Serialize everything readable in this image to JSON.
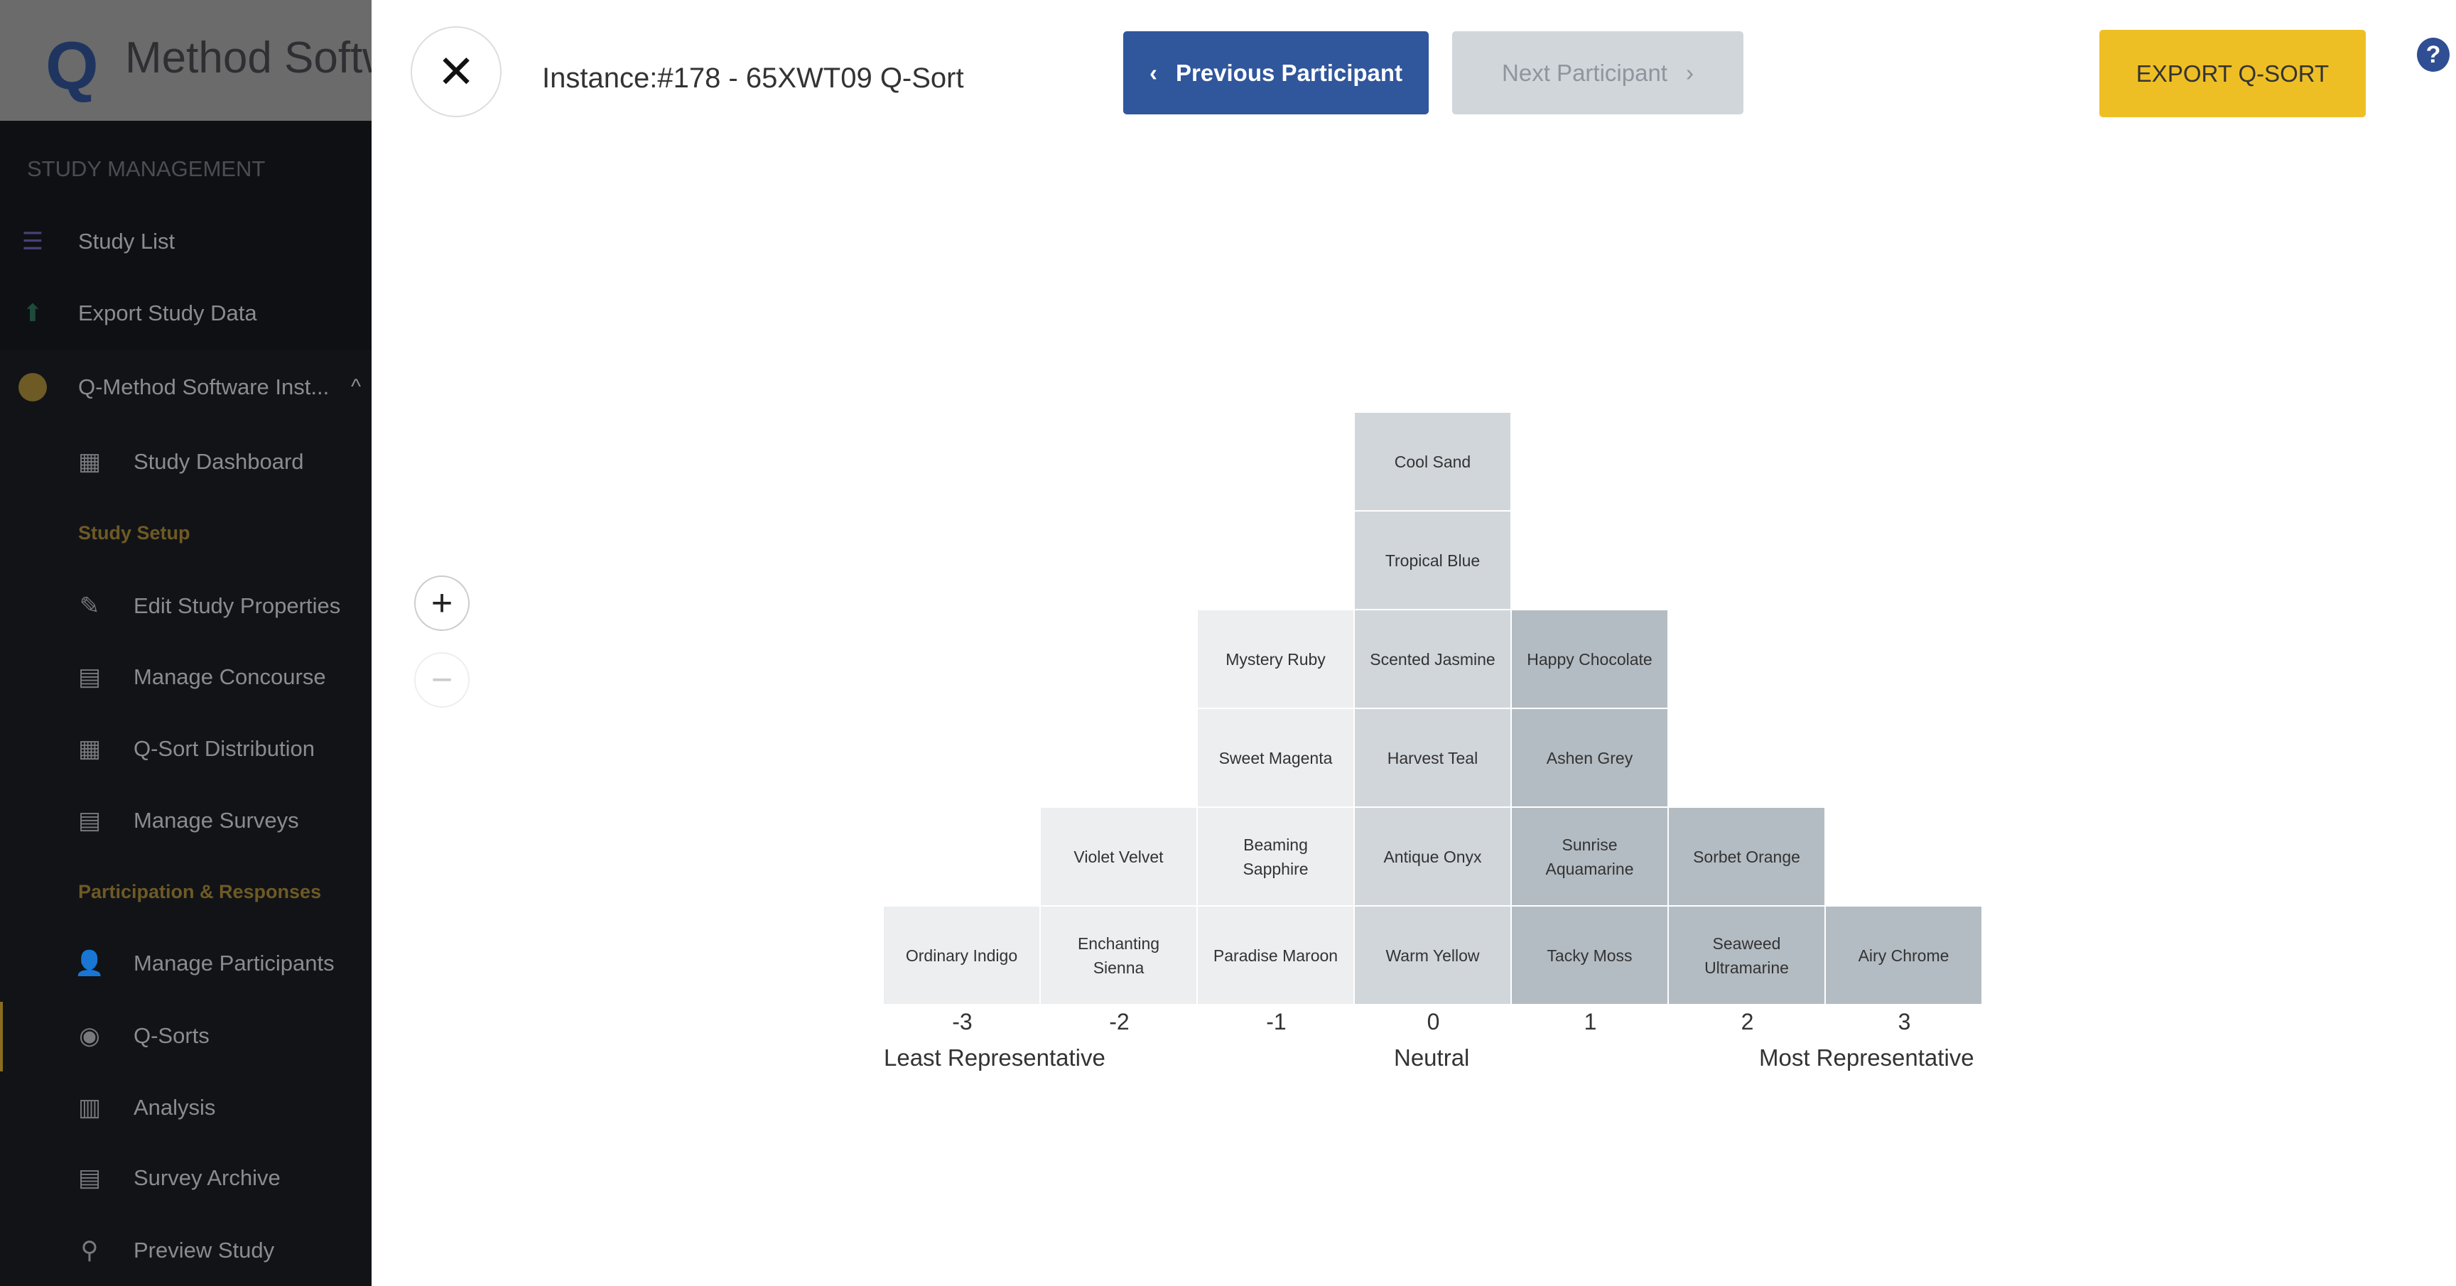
{
  "sidebar": {
    "logo_text": "Method Software",
    "logo_letter": "Q",
    "section_title": "STUDY MANAGEMENT",
    "top_items": [
      {
        "label": "Study List",
        "icon": "list-icon"
      },
      {
        "label": "Export Study Data",
        "icon": "upload-icon"
      },
      {
        "label": "Q-Method Software Inst...",
        "icon": "compass-icon"
      }
    ],
    "sub_items": [
      {
        "label": "Study Dashboard",
        "icon": "dashboard-icon"
      }
    ],
    "group_setup": "Study Setup",
    "setup_items": [
      {
        "label": "Edit Study Properties"
      },
      {
        "label": "Manage Concourse"
      },
      {
        "label": "Q-Sort Distribution"
      },
      {
        "label": "Manage Surveys"
      }
    ],
    "group_participation": "Participation & Responses",
    "participation_items": [
      {
        "label": "Manage Participants"
      },
      {
        "label": "Q-Sorts"
      },
      {
        "label": "Analysis"
      },
      {
        "label": "Survey Archive"
      },
      {
        "label": "Preview Study"
      }
    ],
    "active_item": "Q-Sorts"
  },
  "header": {
    "title": "Instance:#178 - 65XWT09 Q-Sort",
    "prev_label": "Previous Participant",
    "next_label": "Next Participant",
    "export_label": "EXPORT Q-SORT",
    "help": "?"
  },
  "colors": {
    "negative": "#eceef0",
    "neutral": "#d1d6db",
    "positive": "#b4bcc3",
    "primary": "#30569c",
    "accent": "#eebf25"
  },
  "qsort": {
    "columns": [
      {
        "score": "-3",
        "cards": [
          "Ordinary Indigo"
        ]
      },
      {
        "score": "-2",
        "cards": [
          "Enchanting Sienna",
          "Violet Velvet"
        ]
      },
      {
        "score": "-1",
        "cards": [
          "Paradise Maroon",
          "Beaming Sapphire",
          "Sweet Magenta",
          "Mystery Ruby"
        ]
      },
      {
        "score": "0",
        "cards": [
          "Warm Yellow",
          "Antique Onyx",
          "Harvest Teal",
          "Scented Jasmine",
          "Tropical Blue",
          "Cool Sand"
        ]
      },
      {
        "score": "1",
        "cards": [
          "Tacky Moss",
          "Sunrise Aquamarine",
          "Ashen Grey",
          "Happy Chocolate"
        ]
      },
      {
        "score": "2",
        "cards": [
          "Seaweed Ultramarine",
          "Sorbet Orange"
        ]
      },
      {
        "score": "3",
        "cards": [
          "Airy Chrome"
        ]
      }
    ],
    "least_label": "Least Representative",
    "neutral_label": "Neutral",
    "most_label": "Most Representative"
  }
}
